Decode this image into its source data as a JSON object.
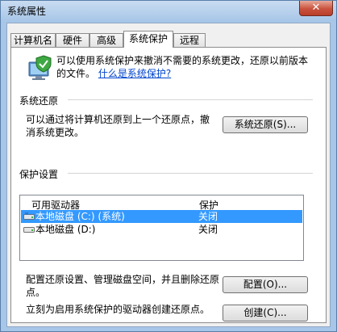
{
  "window": {
    "title": "系统属性",
    "close_glyph": "✕"
  },
  "tabs": [
    {
      "label": "计算机名"
    },
    {
      "label": "硬件"
    },
    {
      "label": "高级"
    },
    {
      "label": "系统保护",
      "active": true
    },
    {
      "label": "远程"
    }
  ],
  "intro": {
    "text": "可以使用系统保护来撤消不需要的系统更改，还原以前版本的文件。",
    "link": "什么是系统保护?"
  },
  "restore": {
    "heading": "系统还原",
    "desc": "可以通过将计算机还原到上一个还原点，撤消系统更改。",
    "button": "系统还原(S)..."
  },
  "protection": {
    "heading": "保护设置",
    "columns": {
      "drive": "可用驱动器",
      "protection": "保护"
    },
    "rows": [
      {
        "drive": "本地磁盘 (C:) (系统)",
        "status": "关闭",
        "selected": true
      },
      {
        "drive": "本地磁盘 (D:)",
        "status": "关闭",
        "selected": false
      }
    ],
    "configure_desc": "配置还原设置、管理磁盘空间，并且删除还原点。",
    "configure_button": "配置(O)...",
    "create_desc": "立刻为启用系统保护的驱动器创建还原点。",
    "create_button": "创建(C)..."
  }
}
